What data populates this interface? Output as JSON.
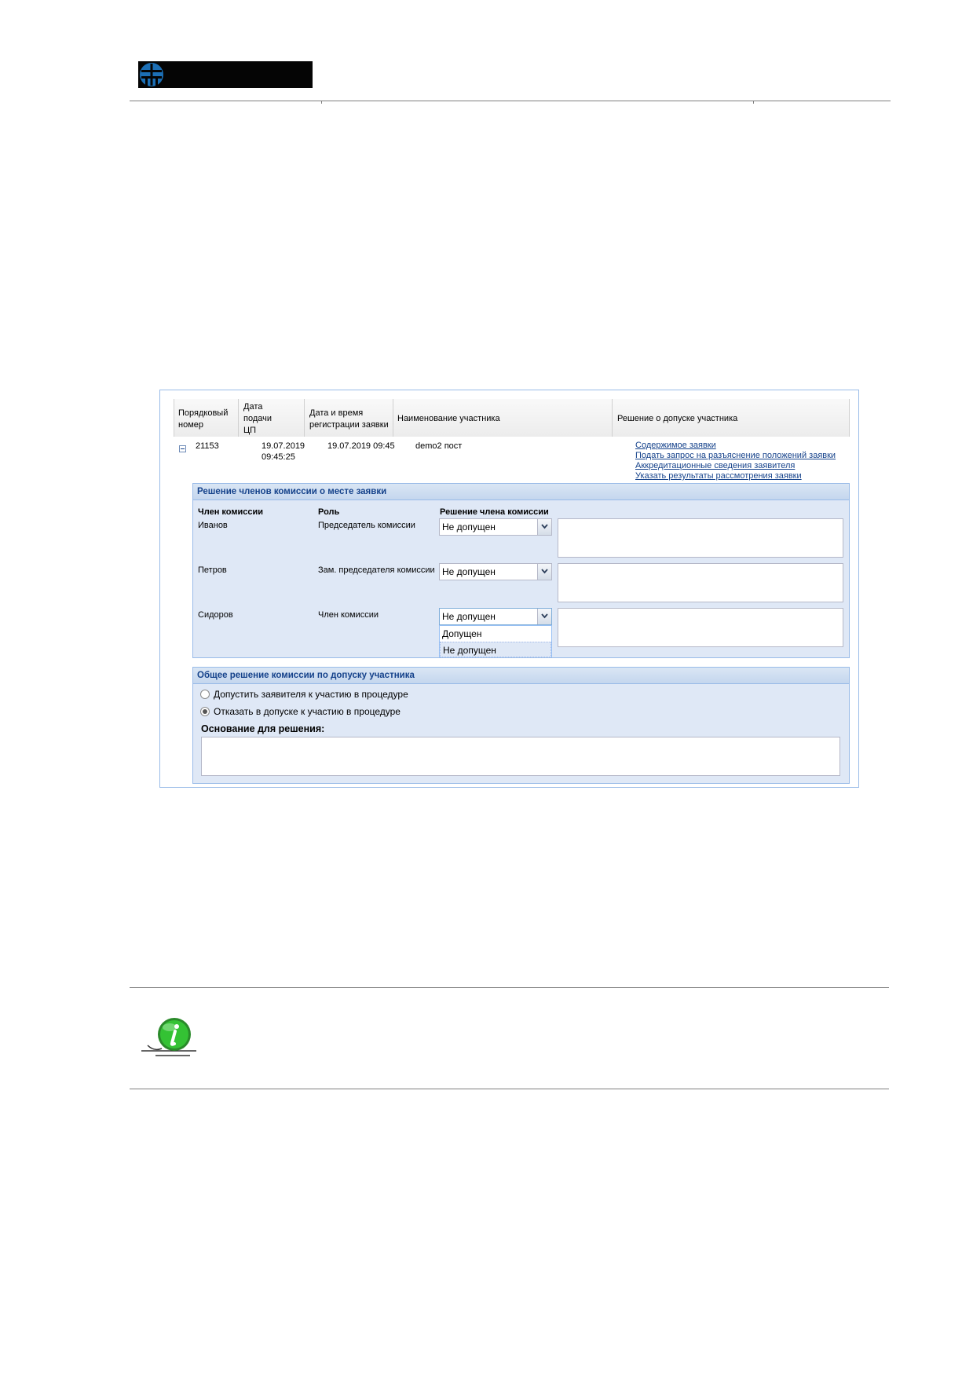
{
  "grid": {
    "headers": [
      [
        "Порядковый",
        "номер"
      ],
      [
        "Дата",
        "подачи",
        "ЦП"
      ],
      [
        "Дата и время",
        "регистрации заявки"
      ],
      [
        "Наименование участника"
      ],
      [
        "Решение о допуске участника"
      ]
    ],
    "row": {
      "number": "21153",
      "submit_date": "19.07.2019",
      "submit_time": "09:45:25",
      "reg_datetime": "19.07.2019 09:45",
      "participant": "demo2 пост",
      "links": [
        "Содержимое заявки",
        "Подать запрос на разъяснение положений заявки",
        "Аккредитационные сведения заявителя",
        "Указать результаты рассмотрения заявки"
      ]
    }
  },
  "members_panel": {
    "title": "Решение членов комиссии о месте заявки",
    "col_member": "Член комиссии",
    "col_role": "Роль",
    "col_decision": "Решение члена комиссии",
    "members": [
      {
        "name": "Иванов",
        "role": "Председатель комиссии",
        "decision": "Не допущен"
      },
      {
        "name": "Петров",
        "role": "Зам. председателя комиссии",
        "decision": "Не допущен"
      },
      {
        "name": "Сидоров",
        "role": "Член комиссии",
        "decision": "Не допущен"
      }
    ],
    "dropdown_options": [
      "Допущен",
      "Не допущен"
    ]
  },
  "general_panel": {
    "title": "Общее решение комиссии по допуску участника",
    "options": [
      {
        "label": "Допустить заявителя к участию в процедуре",
        "selected": false
      },
      {
        "label": "Отказать в допуске к участию в процедуре",
        "selected": true
      }
    ],
    "basis_label": "Основание для решения:"
  },
  "colors": {
    "panel_bg": "#dfe8f6",
    "panel_border": "#99bbe8",
    "header_text": "#15428b",
    "info_icon": "#1e9e1e"
  },
  "icons": [
    "logo-icon",
    "collapse-icon",
    "chevron-down-icon",
    "info-icon"
  ]
}
